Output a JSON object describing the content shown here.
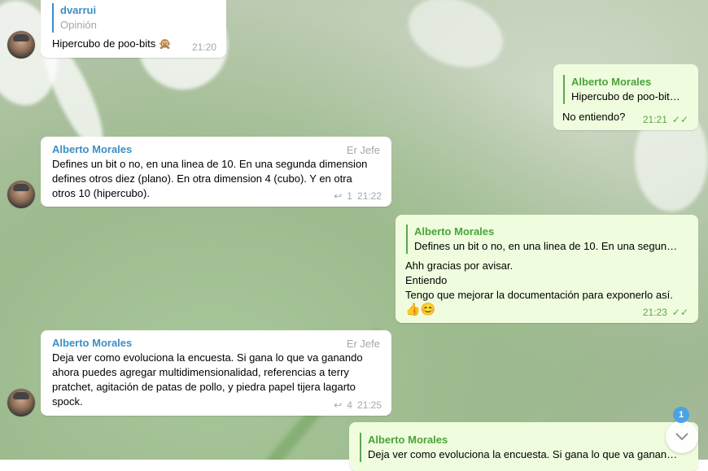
{
  "messages": [
    {
      "id": "m1",
      "sender": "dvarrui",
      "role": "Opinión",
      "text": "Hipercubo de poo-bits 🙊",
      "time": "21:20"
    },
    {
      "id": "m2",
      "reply_to": {
        "name": "Alberto Morales",
        "text": "Hipercubo de poo-bit…"
      },
      "text": "No entiendo?",
      "time": "21:21"
    },
    {
      "id": "m3",
      "sender": "Alberto Morales",
      "role": "Er Jefe",
      "lines": [
        "Defines un bit o no, en una linea de 10. En una segunda dimension",
        "defines otros diez (plano). En otra dimension 4 (cubo). Y en otra",
        "otros 10 (hipercubo)."
      ],
      "replies": "1",
      "time": "21:22"
    },
    {
      "id": "m4",
      "reply_to": {
        "name": "Alberto Morales",
        "text": "Defines un bit o no, en una linea de 10. En una segun…"
      },
      "lines": [
        "Ahh gracias  por avisar.",
        "Entiendo",
        "Tengo que mejorar la documentación para exponerlo así."
      ],
      "emojis": "👍😊",
      "time": "21:23"
    },
    {
      "id": "m5",
      "sender": "Alberto Morales",
      "role": "Er Jefe",
      "lines": [
        "Deja ver como evoluciona la encuesta. Si gana lo que va ganando",
        "ahora puedes agregar multidimensionalidad, referencias a terry",
        "pratchet, agitación de patas de pollo, y piedra papel tijera lagarto",
        "spock."
      ],
      "replies": "4",
      "time": "21:25"
    },
    {
      "id": "m6",
      "reply_to": {
        "name": "Alberto Morales",
        "text": "Deja ver como evoluciona la encuesta. Si gana lo que va ganan…"
      }
    }
  ],
  "scroll_down": {
    "unread_count": "1",
    "icon": "chevron-down-icon"
  },
  "colors": {
    "outgoing_bubble": "#effdde",
    "incoming_bubble": "#ffffff",
    "accent": "#3a8fc5",
    "badge": "#4ba3e2"
  }
}
